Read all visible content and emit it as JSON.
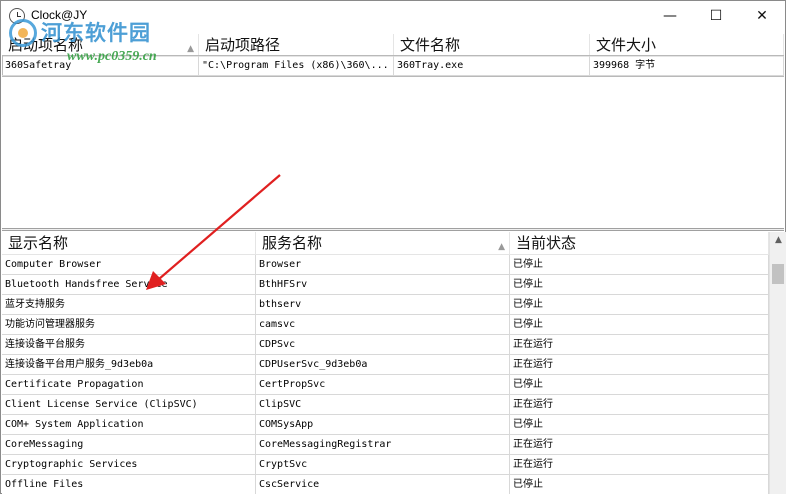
{
  "window": {
    "title": "Clock@JY",
    "minimize_glyph": "—",
    "maximize_glyph": "☐",
    "close_glyph": "✕"
  },
  "watermark": {
    "title": "河东软件园",
    "url": "www.pc0359.cn"
  },
  "startup_list": {
    "columns": [
      "启动项名称",
      "启动项路径",
      "文件名称",
      "文件大小"
    ],
    "rows": [
      [
        "360Safetray",
        "\"C:\\Program Files (x86)\\360\\...",
        "360Tray.exe",
        "399968 字节"
      ]
    ]
  },
  "services_list": {
    "columns": [
      "显示名称",
      "服务名称",
      "当前状态"
    ],
    "sorted_column": "服务名称",
    "rows": [
      [
        "Computer Browser",
        "Browser",
        "已停止"
      ],
      [
        "Bluetooth Handsfree Service",
        "BthHFSrv",
        "已停止"
      ],
      [
        "蓝牙支持服务",
        "bthserv",
        "已停止"
      ],
      [
        "功能访问管理器服务",
        "camsvc",
        "已停止"
      ],
      [
        "连接设备平台服务",
        "CDPSvc",
        "正在运行"
      ],
      [
        "连接设备平台用户服务_9d3eb0a",
        "CDPUserSvc_9d3eb0a",
        "正在运行"
      ],
      [
        "Certificate Propagation",
        "CertPropSvc",
        "已停止"
      ],
      [
        "Client License Service (ClipSVC)",
        "ClipSVC",
        "正在运行"
      ],
      [
        "COM+ System Application",
        "COMSysApp",
        "已停止"
      ],
      [
        "CoreMessaging",
        "CoreMessagingRegistrar",
        "正在运行"
      ],
      [
        "Cryptographic Services",
        "CryptSvc",
        "正在运行"
      ],
      [
        "Offline Files",
        "CscService",
        "已停止"
      ]
    ]
  },
  "colors": {
    "annotation_arrow": "#e02020",
    "watermark_blue": "#2f8fcf",
    "watermark_green": "#35a043"
  }
}
